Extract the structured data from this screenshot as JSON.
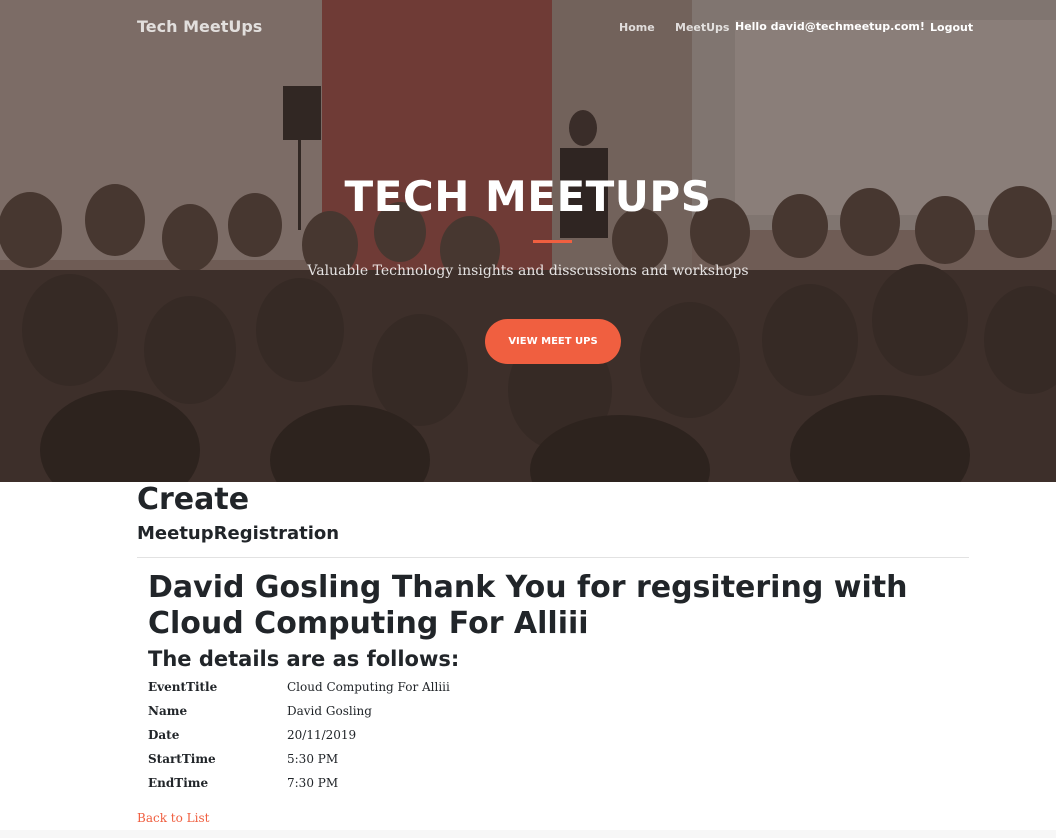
{
  "colors": {
    "accent": "#f05f40",
    "hero_overlay": "#6e5a52",
    "text": "#212529"
  },
  "navbar": {
    "brand": "Tech MeetUps",
    "links": {
      "home": "Home",
      "meetups": "MeetUps",
      "greeting": "Hello david@techmeetup.com!",
      "logout": "Logout"
    }
  },
  "hero": {
    "title": "TECH MEETUPS",
    "subtitle": "Valuable Technology insights and disscussions and workshops",
    "button_label": "VIEW MEET UPS"
  },
  "page": {
    "title": "Create",
    "subtitle": "MeetupRegistration"
  },
  "confirmation": {
    "message": "David Gosling Thank You for regsitering with Cloud Computing For Alliii",
    "details_heading": "The details are as follows:",
    "details": [
      {
        "label": "EventTitle",
        "value": "Cloud Computing For Alliii"
      },
      {
        "label": "Name",
        "value": "David Gosling"
      },
      {
        "label": "Date",
        "value": "20/11/2019"
      },
      {
        "label": "StartTime",
        "value": "5:30 PM"
      },
      {
        "label": "EndTime",
        "value": "7:30 PM"
      }
    ]
  },
  "back_link": "Back to List"
}
